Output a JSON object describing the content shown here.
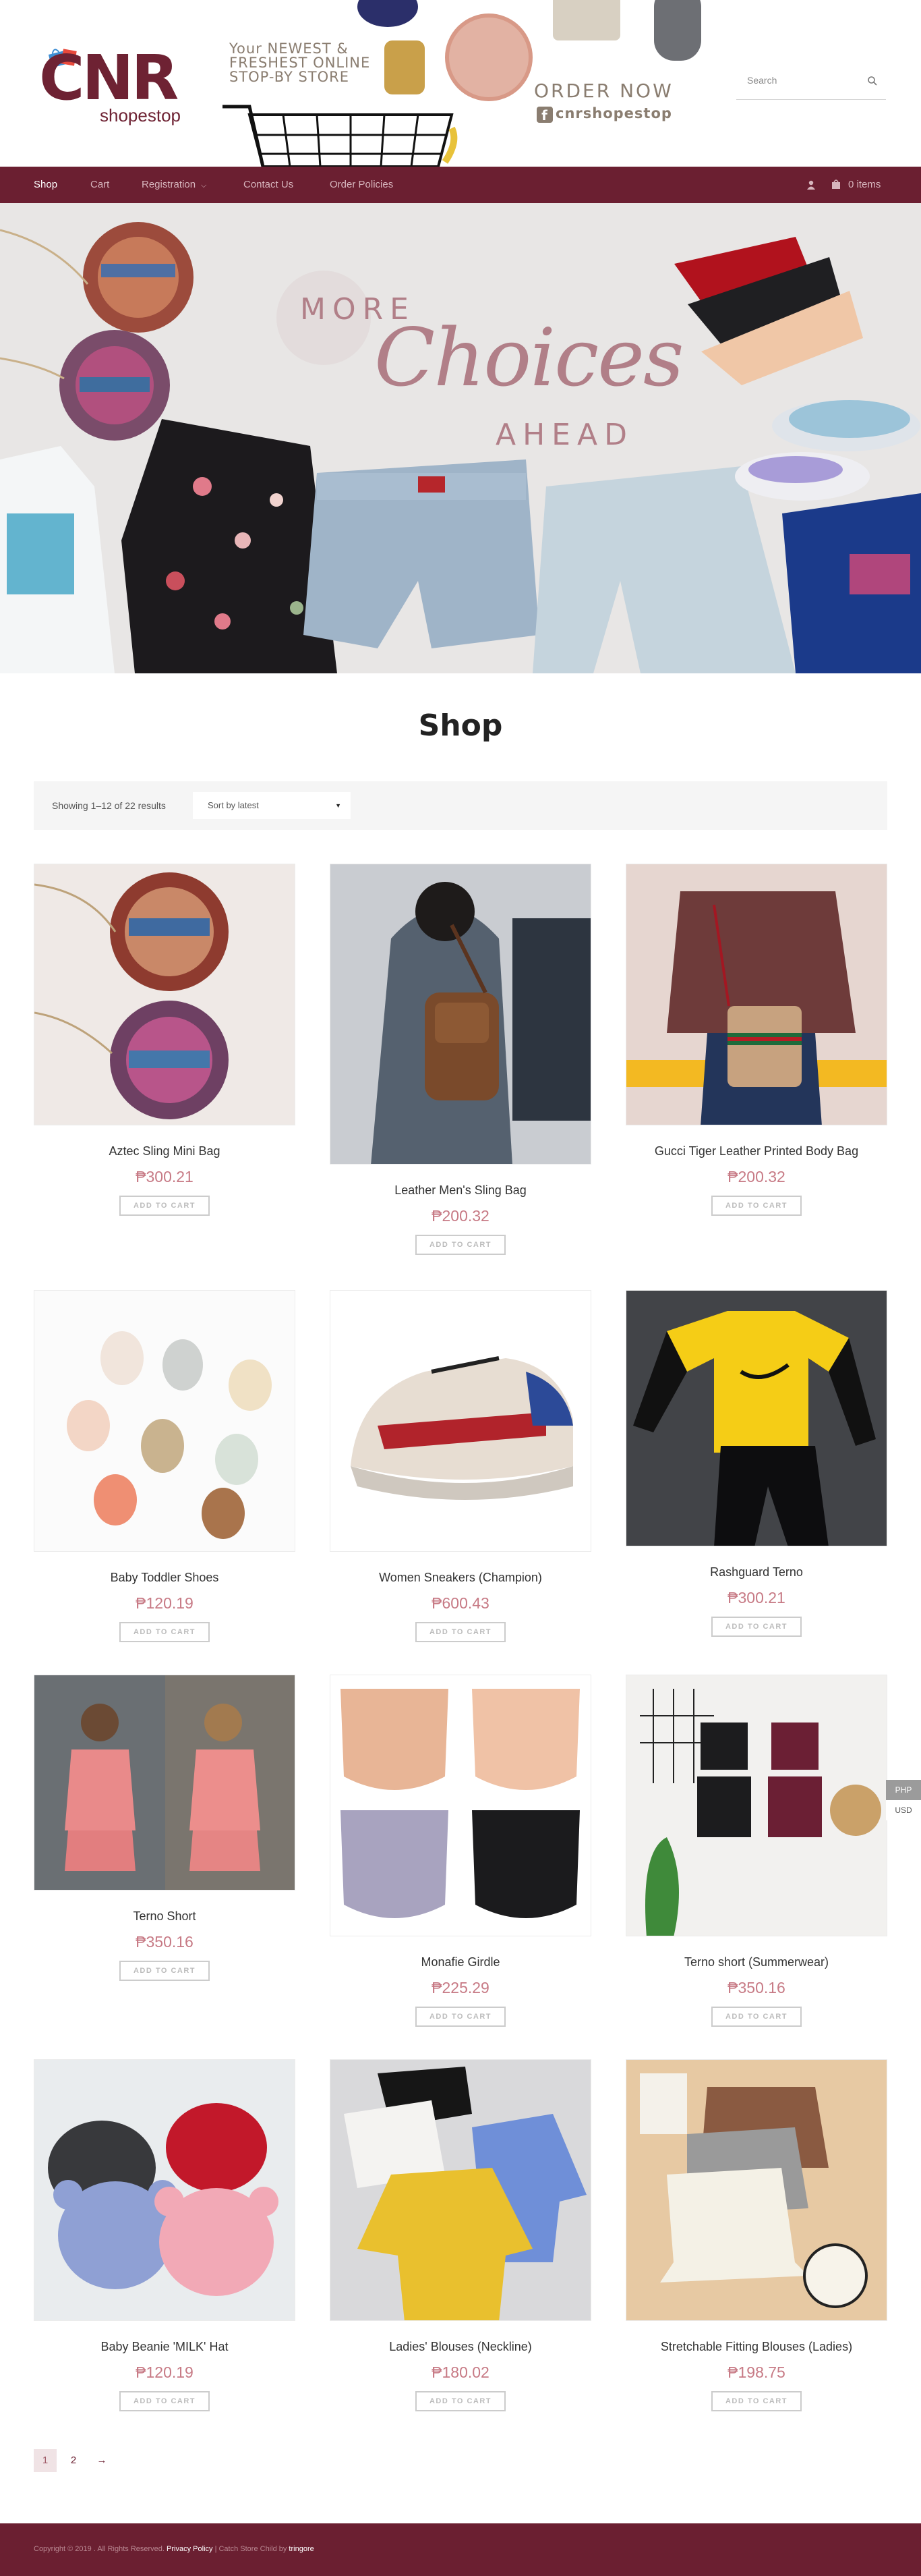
{
  "brand": {
    "logo_text": "CNR",
    "logo_sub": "shopestop"
  },
  "banner": {
    "tagline_1": "Your NEWEST &",
    "tagline_2": "FRESHEST ONLINE",
    "tagline_3": "STOP-BY STORE",
    "order_now": "ORDER NOW",
    "fb_handle": "cnrshopestop"
  },
  "search": {
    "placeholder": "Search"
  },
  "nav": {
    "items": [
      {
        "label": "Shop"
      },
      {
        "label": "Cart"
      },
      {
        "label": "Registration"
      },
      {
        "label": "Contact Us"
      },
      {
        "label": "Order Policies"
      }
    ],
    "cart_count": "0 items"
  },
  "hero": {
    "more": "MORE",
    "choices": "Choices",
    "ahead": "AHEAD"
  },
  "shop": {
    "title": "Shop",
    "result_count": "Showing 1–12 of 22 results",
    "sort_value": "Sort by latest",
    "add_to_cart": "Add to cart"
  },
  "products": [
    {
      "name": "Aztec Sling Mini Bag",
      "price": "₱300.21",
      "image": "aztec-bag-photo"
    },
    {
      "name": "Leather Men's Sling Bag",
      "price": "₱200.32",
      "image": "leather-sling-photo"
    },
    {
      "name": "Gucci Tiger Leather Printed Body Bag",
      "price": "₱200.32",
      "image": "gucci-bag-photo"
    },
    {
      "name": "Baby Toddler Shoes",
      "price": "₱120.19",
      "image": "toddler-shoes-photo"
    },
    {
      "name": "Women Sneakers (Champion)",
      "price": "₱600.43",
      "image": "sneakers-photo"
    },
    {
      "name": "Rashguard Terno",
      "price": "₱300.21",
      "image": "rashguard-photo"
    },
    {
      "name": "Terno Short",
      "price": "₱350.16",
      "image": "terno-short-photo"
    },
    {
      "name": "Monafie Girdle",
      "price": "₱225.29",
      "image": "girdle-photo"
    },
    {
      "name": "Terno short (Summerwear)",
      "price": "₱350.16",
      "image": "summerwear-photo"
    },
    {
      "name": "Baby Beanie 'MILK' Hat",
      "price": "₱120.19",
      "image": "beanie-photo"
    },
    {
      "name": "Ladies' Blouses (Neckline)",
      "price": "₱180.02",
      "image": "blouses-photo"
    },
    {
      "name": "Stretchable Fitting Blouses (Ladies)",
      "price": "₱198.75",
      "image": "fitting-blouses-photo"
    }
  ],
  "currency": {
    "php": "PHP",
    "usd": "USD"
  },
  "pagination": {
    "page_1": "1",
    "page_2": "2",
    "next": "→"
  },
  "footer": {
    "copyright": "Copyright © 2019 . All Rights Reserved. ",
    "privacy": "Privacy Policy",
    "sep": " | Catch Store Child by ",
    "author": "tringore"
  },
  "colors": {
    "brand": "#6b1f31",
    "price": "#c77a85",
    "hero_text": "#b17f88"
  }
}
